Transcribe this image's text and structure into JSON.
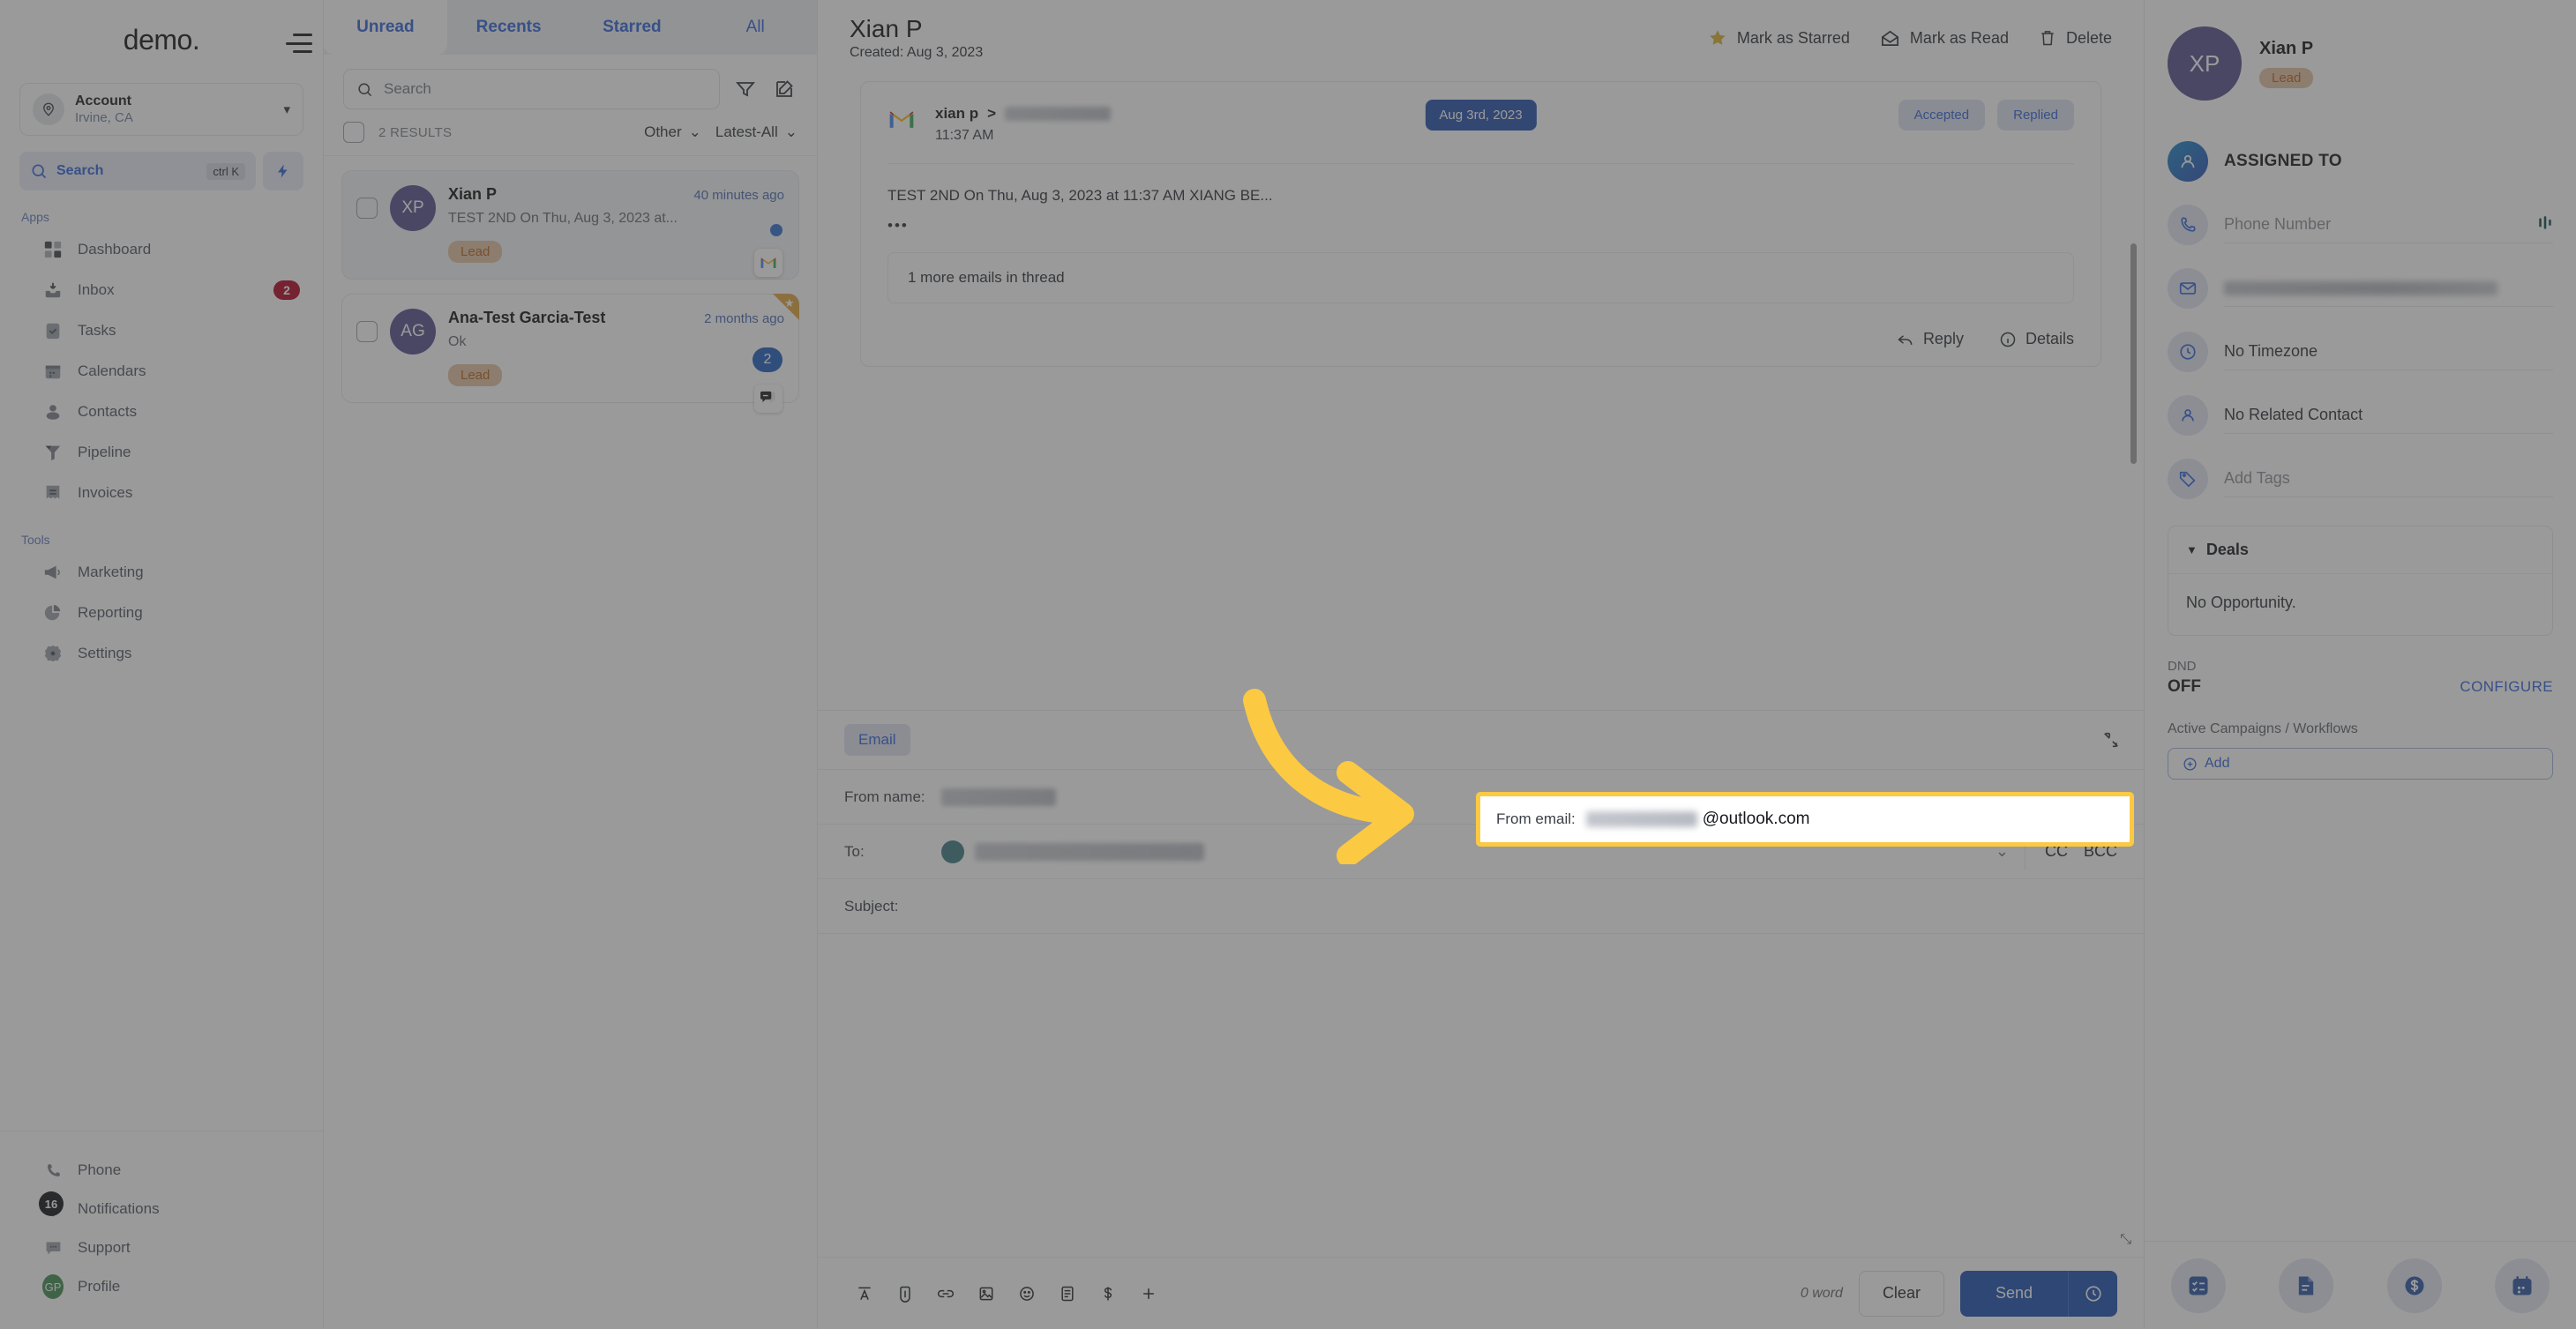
{
  "leftnav": {
    "brand": "demo.",
    "hamburger_icon": "hamburger-menu-icon",
    "account": {
      "name": "Account",
      "location": "Irvine, CA",
      "icon": "location-pin-icon",
      "chevron": "chevron-down-icon"
    },
    "search": {
      "label": "Search",
      "shortcut": "ctrl K",
      "icon": "search-icon"
    },
    "bolt_icon": "lightning-bolt-icon",
    "sections": [
      {
        "title": "Apps",
        "items": [
          {
            "label": "Dashboard",
            "icon": "dashboard-grid-icon",
            "badge": ""
          },
          {
            "label": "Inbox",
            "icon": "inbox-icon",
            "badge": "2"
          },
          {
            "label": "Tasks",
            "icon": "tasks-clipboard-icon",
            "badge": ""
          },
          {
            "label": "Calendars",
            "icon": "calendar-icon",
            "badge": ""
          },
          {
            "label": "Contacts",
            "icon": "contacts-person-icon",
            "badge": ""
          },
          {
            "label": "Pipeline",
            "icon": "pipeline-funnel-icon",
            "badge": ""
          },
          {
            "label": "Invoices",
            "icon": "invoices-list-icon",
            "badge": ""
          }
        ]
      },
      {
        "title": "Tools",
        "items": [
          {
            "label": "Marketing",
            "icon": "megaphone-icon",
            "badge": ""
          },
          {
            "label": "Reporting",
            "icon": "pie-chart-icon",
            "badge": ""
          },
          {
            "label": "Settings",
            "icon": "gear-icon",
            "badge": ""
          }
        ]
      }
    ],
    "bottom": [
      {
        "label": "Phone",
        "icon": "phone-icon",
        "badge": ""
      },
      {
        "label": "Notifications",
        "icon": "bell-icon",
        "badge": "16"
      },
      {
        "label": "Support",
        "icon": "chat-support-icon",
        "badge": ""
      },
      {
        "label": "Profile",
        "icon": "avatar-icon",
        "avatar_initials": "GP"
      }
    ]
  },
  "convlist": {
    "tabs": [
      {
        "label": "Unread",
        "active": true
      },
      {
        "label": "Recents",
        "active": false
      },
      {
        "label": "Starred",
        "active": false
      },
      {
        "label": "All",
        "active": false
      }
    ],
    "search_placeholder": "Search",
    "search_value": "",
    "filter_icon": "filter-funnel-icon",
    "compose_icon": "compose-pencil-icon",
    "results_count": "2 RESULTS",
    "sort_type": "Other",
    "sort_order": "Latest-All",
    "items": [
      {
        "initials": "XP",
        "name": "Xian P",
        "time": "40 minutes ago",
        "preview": "TEST 2ND On Thu, Aug 3, 2023 at...",
        "tag": "Lead",
        "unread_dot": true,
        "count": "",
        "channel_icon": "gmail-icon",
        "starred": false,
        "selected": true
      },
      {
        "initials": "AG",
        "name": "Ana-Test Garcia-Test",
        "time": "2 months ago",
        "preview": "Ok",
        "tag": "Lead",
        "unread_dot": false,
        "count": "2",
        "channel_icon": "sms-chat-icon",
        "starred": true,
        "selected": false
      }
    ]
  },
  "main": {
    "title": "Xian P",
    "created": "Created: Aug 3, 2023",
    "actions": [
      {
        "label": "Mark as Starred",
        "icon": "star-icon"
      },
      {
        "label": "Mark as Read",
        "icon": "open-envelope-icon"
      },
      {
        "label": "Delete",
        "icon": "trash-icon"
      }
    ],
    "message": {
      "channel_icon": "gmail-icon",
      "from": "xian p",
      "arrow": ">",
      "to_redacted": true,
      "time": "11:37 AM",
      "date_pill": "Aug 3rd, 2023",
      "status_pills": [
        "Accepted",
        "Replied"
      ],
      "body": "TEST 2ND On Thu, Aug 3, 2023 at 11:37 AM XIANG BE...",
      "ellipsis": "•••",
      "thread_more": "1 more emails in thread",
      "footer": [
        {
          "label": "Reply",
          "icon": "reply-arrow-icon"
        },
        {
          "label": "Details",
          "icon": "info-circle-icon"
        }
      ]
    }
  },
  "composer": {
    "tab": "Email",
    "collapse_icon": "collapse-diagonal-icon",
    "from_name_label": "From name:",
    "from_name_value_redacted": true,
    "to_label": "To:",
    "to_value_redacted": true,
    "to_chevron": "chevron-down-icon",
    "cc_label": "CC",
    "bcc_label": "BCC",
    "subject_label": "Subject:",
    "subject_value": "",
    "body_value": "",
    "resize_handle": "resize-handle-icon",
    "toolbar_icons": [
      "text-format-icon",
      "attachment-paperclip-icon",
      "link-icon",
      "image-icon",
      "emoji-smiley-icon",
      "template-document-icon",
      "dollar-payment-icon",
      "plus-more-icon"
    ],
    "word_count": "0 word",
    "clear_label": "Clear",
    "send_label": "Send",
    "send_later_icon": "clock-schedule-icon"
  },
  "highlight": {
    "from_email_label": "From email:",
    "from_email_redacted": true,
    "from_email_domain": "@outlook.com",
    "border_color": "#FBC942",
    "arrow_color": "#FBC942",
    "arrow_icon": "curved-arrow-right-icon"
  },
  "rightpanel": {
    "avatar_initials": "XP",
    "name": "Xian P",
    "tag": "Lead",
    "assigned_to_label": "ASSIGNED TO",
    "assigned_icon": "person-avatar-icon",
    "fields": [
      {
        "icon": "phone-icon",
        "placeholder": "Phone Number",
        "value": "",
        "redacted": false,
        "trailing_icon": "signal-bars-icon"
      },
      {
        "icon": "envelope-icon",
        "placeholder": "",
        "value": "",
        "redacted": true,
        "trailing_icon": ""
      },
      {
        "icon": "clock-icon",
        "placeholder": "",
        "value": "No Timezone",
        "redacted": false,
        "trailing_icon": ""
      },
      {
        "icon": "person-icon",
        "placeholder": "",
        "value": "No Related Contact",
        "redacted": false,
        "trailing_icon": ""
      },
      {
        "icon": "tag-icon",
        "placeholder": "Add Tags",
        "value": "",
        "redacted": false,
        "trailing_icon": ""
      }
    ],
    "deals_title": "Deals",
    "deals_caret": "caret-down-icon",
    "deals_empty": "No Opportunity.",
    "dnd_label": "DND",
    "dnd_value": "OFF",
    "configure_label": "CONFIGURE",
    "campaigns_label": "Active Campaigns / Workflows",
    "add_label": "Add",
    "add_icon": "plus-circle-icon",
    "bottom_icons": [
      "tasks-checklist-icon",
      "notes-document-icon",
      "payments-dollar-icon",
      "appointments-calendar-icon"
    ]
  }
}
